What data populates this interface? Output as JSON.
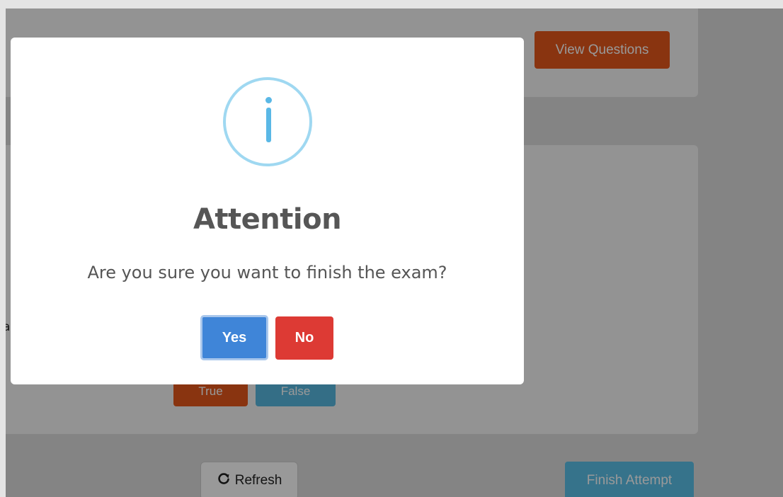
{
  "background_page": {
    "view_questions_label": "View Questions",
    "statement_edge_text": "a",
    "true_label": "True",
    "false_label": "False",
    "refresh_label": "Refresh",
    "finish_attempt_label": "Finish Attempt"
  },
  "modal": {
    "icon": "info-icon",
    "title": "Attention",
    "message": "Are you sure you want to finish the exam?",
    "yes_label": "Yes",
    "no_label": "No"
  },
  "colors": {
    "accent_orange": "#e4571c",
    "accent_blue": "#58b8df",
    "yes_blue": "#3f85d8",
    "no_red": "#dd3a34",
    "info_ring": "#9fd8f1"
  }
}
